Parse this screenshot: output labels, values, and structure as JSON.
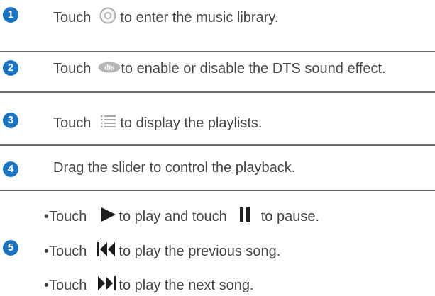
{
  "steps": [
    {
      "number": "1",
      "before": "Touch",
      "icon": "music-library-disc-icon",
      "after": "to enter the music library."
    },
    {
      "number": "2",
      "before": "Touch",
      "icon": "dts-icon",
      "icon_text": "dts",
      "after": "to enable or disable the DTS sound effect."
    },
    {
      "number": "3",
      "before": "Touch",
      "icon": "playlist-icon",
      "after": "to display the playlists."
    },
    {
      "number": "4",
      "text": "Drag the slider to control the playback."
    },
    {
      "number": "5",
      "bullets": [
        {
          "bullet": "•",
          "before": "Touch",
          "icon": "play-icon",
          "middle": "to play and touch",
          "icon2": "pause-icon",
          "after": "to pause."
        },
        {
          "bullet": "•",
          "before": "Touch",
          "icon": "previous-song-icon",
          "after": "to play the previous song."
        },
        {
          "bullet": "•",
          "before": "Touch",
          "icon": "next-song-icon",
          "after": "to play the next song."
        }
      ]
    }
  ],
  "colors": {
    "badge": "#1b74c2",
    "text": "#444444",
    "divider": "#6e6e6e",
    "icon_gray": "#aaaaaa",
    "icon_dark": "#1f1f1f"
  }
}
